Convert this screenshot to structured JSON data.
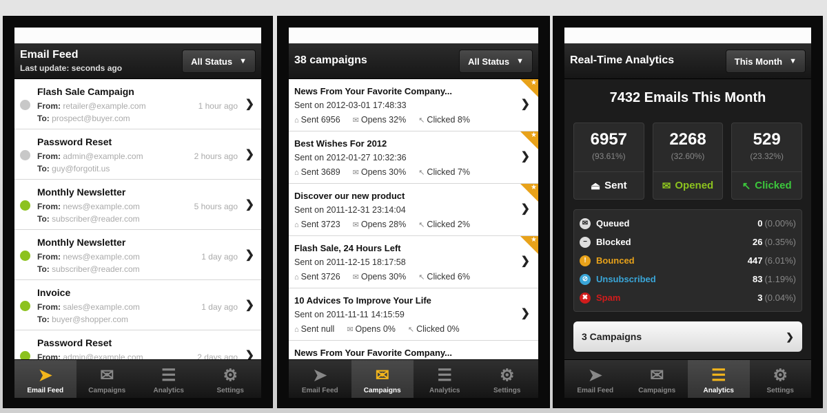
{
  "colors": {
    "accent": "#f2b51c",
    "green_dot": "#8cc21f",
    "gray_dot": "#c8c8c8",
    "opened": "#8cc21f",
    "clicked": "#3cc73c",
    "bounced": "#e8a21a",
    "unsubscribed": "#3aa6d8",
    "spam": "#d01c1c"
  },
  "tabs": [
    {
      "label": "Email Feed",
      "icon": "paper-plane-icon"
    },
    {
      "label": "Campaigns",
      "icon": "envelopes-icon"
    },
    {
      "label": "Analytics",
      "icon": "bars-icon"
    },
    {
      "label": "Settings",
      "icon": "gear-icon"
    }
  ],
  "email_feed": {
    "title": "Email Feed",
    "subtitle": "Last update: seconds ago",
    "filter": "All Status",
    "items": [
      {
        "title": "Flash Sale Campaign",
        "from": "retailer@example.com",
        "to": "prospect@buyer.com",
        "time": "1 hour ago",
        "status": "gray"
      },
      {
        "title": "Password Reset",
        "from": "admin@example.com",
        "to": "guy@forgotit.us",
        "time": "2 hours ago",
        "status": "gray"
      },
      {
        "title": "Monthly Newsletter",
        "from": "news@example.com",
        "to": "subscriber@reader.com",
        "time": "5 hours ago",
        "status": "green"
      },
      {
        "title": "Monthly Newsletter",
        "from": "news@example.com",
        "to": "subscriber@reader.com",
        "time": "1 day ago",
        "status": "green"
      },
      {
        "title": "Invoice",
        "from": "sales@example.com",
        "to": "buyer@shopper.com",
        "time": "1 day ago",
        "status": "green"
      },
      {
        "title": "Password Reset",
        "from": "admin@example.com",
        "to": "",
        "time": "2 days ago",
        "status": "green"
      }
    ],
    "from_label": "From:",
    "to_label": "To:"
  },
  "campaigns": {
    "title": "38 campaigns",
    "filter": "All Status",
    "items": [
      {
        "title": "News From Your Favorite Company...",
        "sent_on": "Sent on 2012-03-01 17:48:33",
        "sent": "Sent 6956",
        "opens": "Opens 32%",
        "clicked": "Clicked 8%",
        "badge": true
      },
      {
        "title": "Best Wishes For 2012",
        "sent_on": "Sent on 2012-01-27 10:32:36",
        "sent": "Sent 3689",
        "opens": "Opens 30%",
        "clicked": "Clicked 7%",
        "badge": true
      },
      {
        "title": "Discover our new product",
        "sent_on": "Sent on 2011-12-31 23:14:04",
        "sent": "Sent 3723",
        "opens": "Opens 28%",
        "clicked": "Clicked 2%",
        "badge": true
      },
      {
        "title": "Flash Sale, 24 Hours Left",
        "sent_on": "Sent on 2011-12-15 18:17:58",
        "sent": "Sent 3726",
        "opens": "Opens 30%",
        "clicked": "Clicked 6%",
        "badge": true
      },
      {
        "title": "10 Advices To Improve Your Life",
        "sent_on": "Sent on 2011-11-11 14:15:59",
        "sent": "Sent null",
        "opens": "Opens 0%",
        "clicked": "Clicked 0%",
        "badge": false
      },
      {
        "title": "News From Your Favorite Company...",
        "sent_on": "",
        "sent": "",
        "opens": "",
        "clicked": "",
        "badge": false
      }
    ]
  },
  "analytics": {
    "title": "Real-Time Analytics",
    "filter": "This Month",
    "headline": "7432 Emails This Month",
    "cards": [
      {
        "value": "6957",
        "pct": "(93.61%)",
        "label": "Sent",
        "icon": "sent-icon",
        "color": "#ffffff"
      },
      {
        "value": "2268",
        "pct": "(32.60%)",
        "label": "Opened",
        "icon": "opened-icon",
        "color": "#8cc21f"
      },
      {
        "value": "529",
        "pct": "(23.32%)",
        "label": "Clicked",
        "icon": "cursor-icon",
        "color": "#3cc73c"
      }
    ],
    "stats": [
      {
        "name": "Queued",
        "count": "0",
        "pct": "(0.00%)",
        "color": "#dddddd",
        "icon": "queued-icon",
        "glyph": "✉"
      },
      {
        "name": "Blocked",
        "count": "26",
        "pct": "(0.35%)",
        "color": "#dddddd",
        "icon": "blocked-icon",
        "glyph": "−"
      },
      {
        "name": "Bounced",
        "count": "447",
        "pct": "(6.01%)",
        "color": "#e8a21a",
        "icon": "bounced-icon",
        "glyph": "!"
      },
      {
        "name": "Unsubscribed",
        "count": "83",
        "pct": "(1.19%)",
        "color": "#3aa6d8",
        "icon": "unsubscribed-icon",
        "glyph": "⊘"
      },
      {
        "name": "Spam",
        "count": "3",
        "pct": "(0.04%)",
        "color": "#d01c1c",
        "icon": "spam-icon",
        "glyph": "✖"
      }
    ],
    "campaigns_button": "3 Campaigns"
  }
}
